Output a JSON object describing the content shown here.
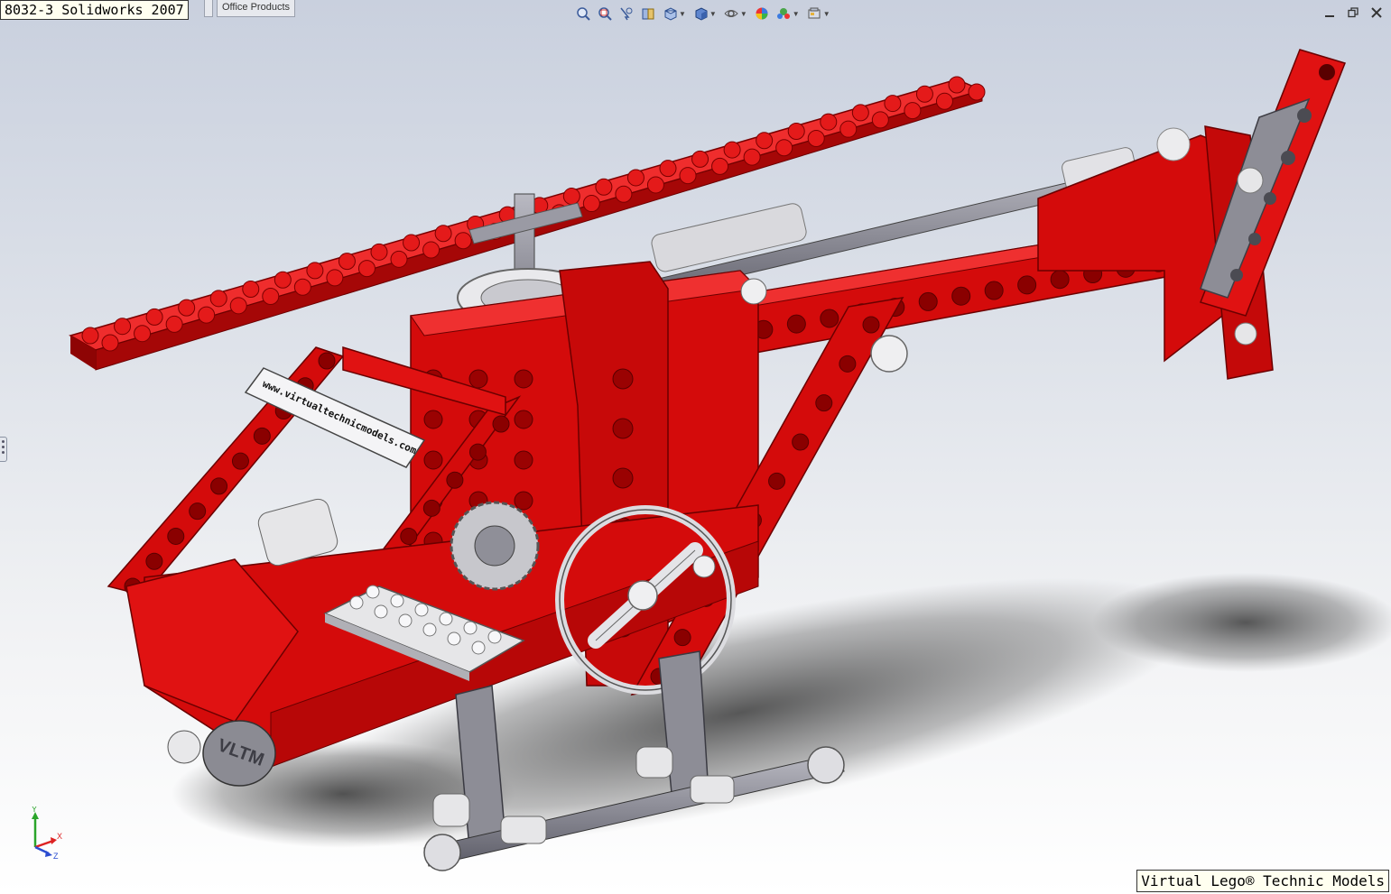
{
  "window": {
    "title": "8032-3 Solidworks 2007",
    "tabs": [
      "",
      "Office Products"
    ]
  },
  "toolbar": {
    "icons": [
      "zoom-to-fit-icon",
      "zoom-area-icon",
      "zoom-selection-icon",
      "section-view-icon",
      "view-orientation-icon",
      "display-style-icon",
      "hide-show-items-icon",
      "edit-appearance-icon",
      "apply-scene-icon",
      "view-settings-icon"
    ]
  },
  "model": {
    "name": "8032-3 Helicopter",
    "sign_text": "www.virtualtechnicmodels.com",
    "logo_text": "VLTM",
    "colors": {
      "brick": "#d40b0b",
      "brick_dark": "#8e0404",
      "brick_light": "#ef3030",
      "gray": "#8d8d96",
      "white": "#e6e6e8"
    }
  },
  "triad": {
    "x": "X",
    "y": "Y",
    "z": "Z"
  },
  "watermark": "Virtual Lego® Technic Models"
}
